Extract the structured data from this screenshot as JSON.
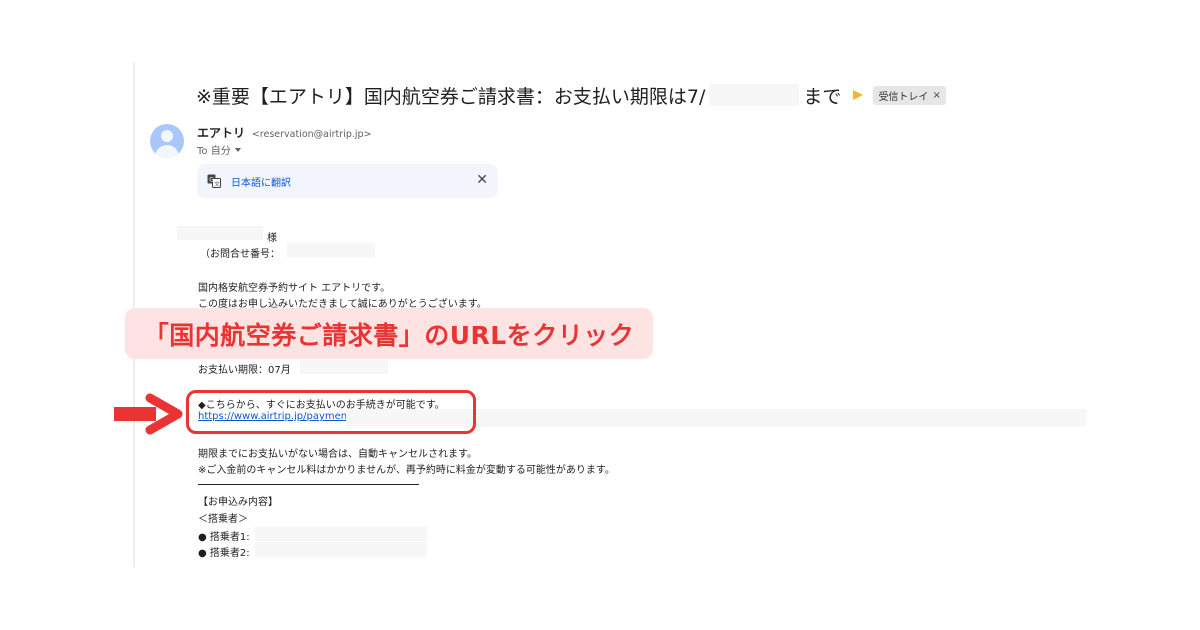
{
  "email": {
    "subject_prefix": "※重要【エアトリ】国内航空券ご請求書：お支払い期限は7/",
    "subject_suffix": "まで",
    "label_chip": "受信トレイ",
    "label_chip_close": "×",
    "sender_name": "エアトリ",
    "sender_email": "<reservation@airtrip.jp>",
    "to_line": "To 自分",
    "translate_label": "日本語に翻訳",
    "translate_close": "✕"
  },
  "body": {
    "salutation": "様",
    "inquiry_label": "（お問合せ番号：",
    "intro_line1": "国内格安航空券予約サイト エアトリです。",
    "intro_line2": "この度はお申し込みいただきまして誠にありがとうございます。",
    "deadline_label": "お支払い期限：07月",
    "payment_heading": "◆こちらから、すぐにお支払いのお手続きが可能です。",
    "payment_link": "https://www.airtrip.jp/payment/",
    "cancel_notice1": "期限までにお支払いがない場合は、自動キャンセルされます。",
    "cancel_notice2": "※ご入金前のキャンセル料はかかりませんが、再予約時に料金が変動する可能性があります。",
    "application_heading": "【お申込み内容】",
    "passengers_heading": "＜搭乗者＞",
    "passenger1": "● 搭乗者1:",
    "passenger2": "● 搭乗者2:"
  },
  "annotation": {
    "callout_text": "「国内航空券ご請求書」のURLをクリック",
    "accent_color": "#ea3434",
    "callout_bg": "#fde3e2"
  },
  "colors": {
    "link": "#0b57d0",
    "avatar": "#a8c7fa",
    "important_marker": "#f2b829",
    "translate_bg": "#f2f6fc"
  }
}
